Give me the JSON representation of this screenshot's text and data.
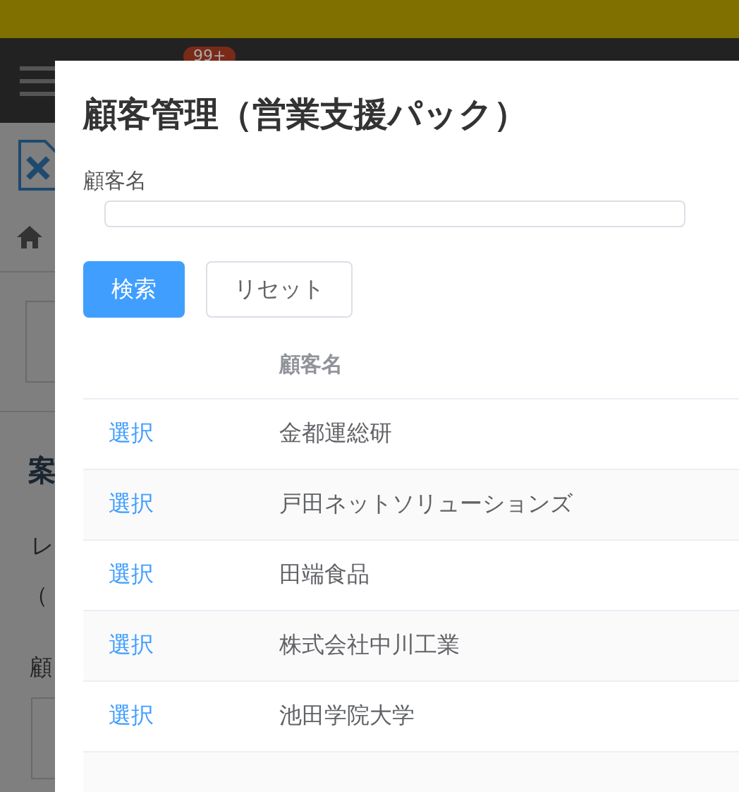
{
  "background": {
    "badge": "99+",
    "heading": "案",
    "line_1": "レ",
    "line_2": "（",
    "label": "顧"
  },
  "dialog": {
    "title": "顧客管理（営業支援パック）",
    "field_label": "顧客名",
    "buttons": [
      {
        "label": "検索",
        "kind": "primary"
      },
      {
        "label": "リセット",
        "kind": "default"
      }
    ],
    "table": {
      "columns": [
        "",
        "顧客名"
      ],
      "rows": [
        {
          "action": "選択",
          "name": "金都運総研"
        },
        {
          "action": "選択",
          "name": "戸田ネットソリューションズ"
        },
        {
          "action": "選択",
          "name": "田端食品"
        },
        {
          "action": "選択",
          "name": "株式会社中川工業"
        },
        {
          "action": "選択",
          "name": "池田学院大学"
        }
      ]
    }
  }
}
